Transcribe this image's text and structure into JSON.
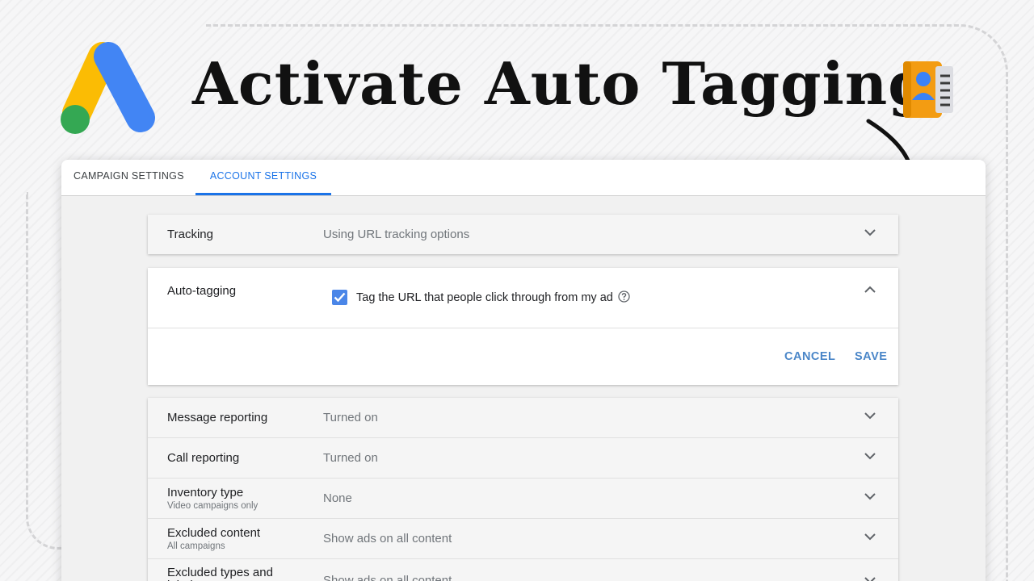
{
  "header": {
    "title": "Activate Auto Tagging"
  },
  "tabs": [
    {
      "label": "CAMPAIGN SETTINGS",
      "active": false
    },
    {
      "label": "ACCOUNT SETTINGS",
      "active": true
    }
  ],
  "tracking": {
    "label": "Tracking",
    "value": "Using URL tracking options"
  },
  "auto_tagging": {
    "label": "Auto-tagging",
    "checkbox_label": "Tag the URL that people click through from my ad",
    "checked": true,
    "cancel_label": "CANCEL",
    "save_label": "SAVE"
  },
  "settings": [
    {
      "label": "Message reporting",
      "sublabel": "",
      "value": "Turned on"
    },
    {
      "label": "Call reporting",
      "sublabel": "",
      "value": "Turned on"
    },
    {
      "label": "Inventory type",
      "sublabel": "Video campaigns only",
      "value": "None"
    },
    {
      "label": "Excluded content",
      "sublabel": "All campaigns",
      "value": "Show ads on all content"
    },
    {
      "label": "Excluded types and labels",
      "sublabel": "",
      "value": "Show ads on all content"
    }
  ],
  "colors": {
    "accent": "#1a73e8",
    "button_text": "#4a86c8",
    "checkbox": "#4a86e8",
    "logo_yellow": "#fbbc04",
    "logo_blue": "#4285f4",
    "logo_green": "#34a853"
  },
  "icons": [
    "google-ads-logo-icon",
    "contact-book-icon",
    "curved-arrow-icon",
    "chevron-down-icon",
    "chevron-up-icon",
    "help-circle-icon",
    "checkmark-icon"
  ]
}
